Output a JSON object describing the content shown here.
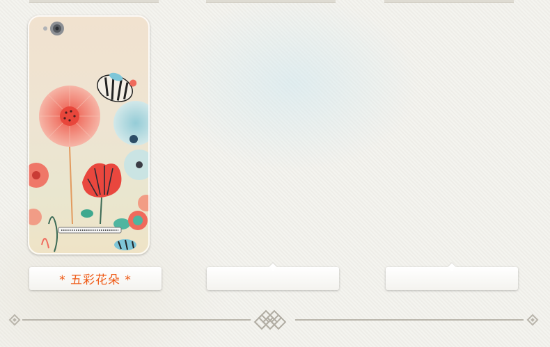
{
  "products": [
    {
      "caption": "* 五彩花朵 *",
      "image": "phone-case-colorful-flowers"
    },
    {
      "caption": "",
      "image": ""
    },
    {
      "caption": "",
      "image": ""
    }
  ],
  "colors": {
    "caption_text": "#ef5a16",
    "background": "#f2f1ec",
    "divider": "#b9b5ab"
  },
  "icons": [
    "camera-lens-icon",
    "speaker-grille-icon",
    "knot-ornament-icon",
    "diamond-end-icon"
  ]
}
